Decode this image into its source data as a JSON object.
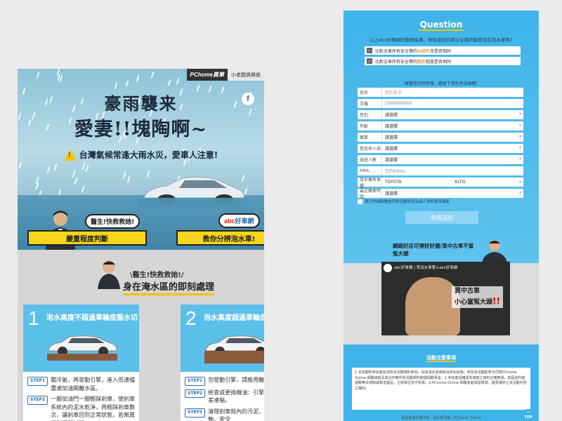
{
  "left": {
    "brand": {
      "logo": "PChome買車",
      "club": "小老闆俱樂部"
    },
    "facebook_icon": "facebook-icon",
    "title_line1": "豪雨襲来",
    "title_line2": "愛妻!!塊陶啊~",
    "warning": "台灣氣候常逢大雨水災，愛車人注意!",
    "doctor_bubble": "醫生!快救救她!",
    "left_bar": "嚴重程度判斷",
    "abc_bubble_logo": "abc",
    "abc_bubble_text": "好車網",
    "right_bar": "教你分辨泡水車!",
    "section_sub": "醫生!快救救她!",
    "section_title": "身在淹水區的即刻處理",
    "cards": [
      {
        "num": "1",
        "title": "泡水高度不超過車輪底盤水切",
        "steps": [
          {
            "tag": "STEP1",
            "text": "關冷氣，再發動引擎，進入低速檔盡速加油開離水區。"
          },
          {
            "tag": "STEP2",
            "text": "一腳加油門一腳輕踩剎車，使剎車系統內的泥水乾淨，再輕踩剎車數次，讓剎車回到正常狀態，若無異況則再開離現"
          }
        ]
      },
      {
        "num": "2",
        "title": "泡水高度超過車輪底盤水切",
        "steps": [
          {
            "tag": "STEP1",
            "text": "勿發動引擎，請推用離開。"
          },
          {
            "tag": "STEP2",
            "text": "檢查或更換機油：引擎、變速箱、差速箱。"
          },
          {
            "tag": "STEP3",
            "text": "清理剎車鼓內的污泥，及檢查輪軸，宋令"
          }
        ]
      }
    ]
  },
  "right": {
    "question_title": "Question",
    "question_text": "以上abc好車網的衝動指導，你知道如何用以全國判斷是否在泡水車嗎？",
    "checks": [
      {
        "pre": "比對全車所有安全帶的",
        "hi": "出廠年",
        "post": "月是否相同"
      },
      {
        "pre": "比對全車所有安全帶的",
        "hi": "顏色",
        "post": "程度是否相同"
      }
    ],
    "form_note": "謝謝您的回答唷，請留下資料參加抽獎!",
    "fields": [
      {
        "label": "姓名",
        "value": "您的名字"
      },
      {
        "label": "手機",
        "value": "0988888888"
      },
      {
        "label": "性別",
        "value": "請選擇"
      },
      {
        "label": "年齡",
        "value": "請選擇"
      },
      {
        "label": "職業",
        "value": "請選擇"
      },
      {
        "label": "是否有小孩",
        "value": "請選擇"
      },
      {
        "label": "家庭人數",
        "value": "請選擇"
      },
      {
        "label": "MAIL",
        "value": "您的EMAIL"
      },
      {
        "label": "目前擁有車種",
        "value": "TOYOTA",
        "value2": "ALTIS"
      },
      {
        "label": "最近購車時間",
        "value": "請選擇"
      }
    ],
    "agree_text": "我已詳細閱讀並同意活動辦法及個人資料使用規範",
    "submit_label": "完成送出",
    "video_bubble": "網路好店可得好好選/買中古車不當冤大頭",
    "video_title": "abc好車網 | 買泡水車驚×abc好車網",
    "video_overlay_1": "買中古車",
    "video_overlay_2": "小心當冤大頭",
    "video_overlay_mark": "!!",
    "notice_title": "活動注意事項",
    "notice_text": "1.本活動所參加者皆須依本活動規則參加，如有違反者將取消參加資格。參加本活動即表示同意PChome Online 網路家庭及其合作夥伴依活動規則辦理相關事宜。2.參加者須確認所填寫之資料正確無誤，如因資料錯誤致無法通知或寄送獎品，主辦單位恕不負責。3.PChome Online 網路家庭保留修改、變更或終止本活動內容之權利。",
    "footer_text": "網路家庭版權所有・隱私權政策・PChome Online",
    "top_label": "TOP"
  },
  "colors": {
    "accent_blue": "#3fb4ea",
    "accent_yellow": "#f7d51d"
  }
}
